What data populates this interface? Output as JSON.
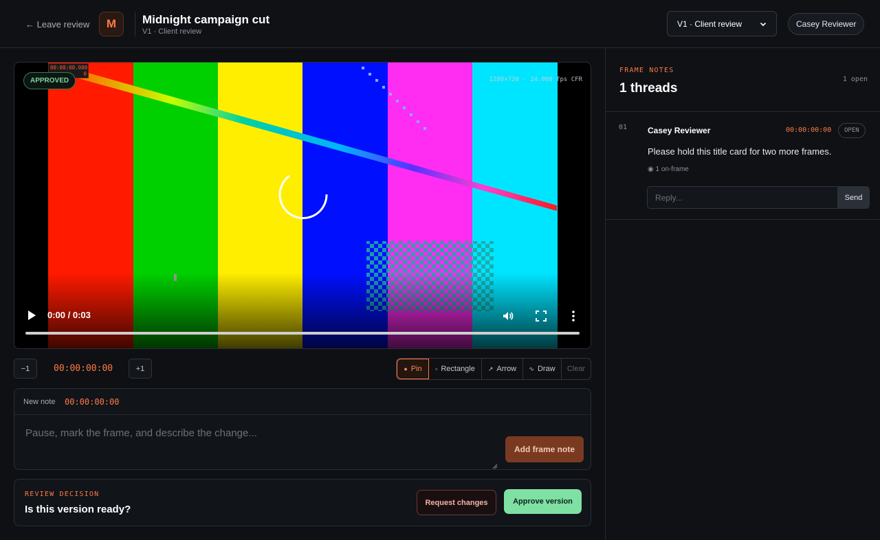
{
  "header": {
    "back_label": "← Leave review",
    "logo_letter": "M",
    "project_title": "Midnight campaign cut",
    "project_subtitle": "V1 · Client review",
    "version_select": "V1 · Client review",
    "user_name": "Casey Reviewer"
  },
  "player": {
    "status_badge": "APPROVED",
    "overlay_timecode": "00:00:00.000",
    "overlay_frame": "0",
    "resolution_label": "1280×720 · 24.000 fps CFR",
    "time_display": "0:00 / 0:03",
    "bar_colors": [
      "#ff1a00",
      "#00d000",
      "#ffee00",
      "#0010ff",
      "#ff2cf2",
      "#00e5ff"
    ]
  },
  "controls": {
    "step_back": "−1",
    "current_timecode": "00:00:00:00",
    "step_forward": "+1",
    "tools": [
      {
        "label": "Pin",
        "glyph": "●"
      },
      {
        "label": "Rectangle",
        "glyph": "▫"
      },
      {
        "label": "Arrow",
        "glyph": "↗"
      },
      {
        "label": "Draw",
        "glyph": "∿"
      },
      {
        "label": "Clear",
        "glyph": ""
      }
    ],
    "active_tool": "Pin"
  },
  "new_note": {
    "label": "New note",
    "timecode": "00:00:00:00",
    "placeholder": "Pause, mark the frame, and describe the change...",
    "submit_label": "Add frame note"
  },
  "decision": {
    "kicker": "REVIEW DECISION",
    "question": "Is this version ready?",
    "request_label": "Request changes",
    "approve_label": "Approve version"
  },
  "sidebar": {
    "kicker": "FRAME NOTES",
    "title": "1 threads",
    "open_count": "1 open",
    "threads": [
      {
        "index": "01",
        "author": "Casey Reviewer",
        "timecode": "00:00:00:00",
        "status": "OPEN",
        "body": "Please hold this title card for two more frames.",
        "meta": "◉ 1 on-frame",
        "reply_placeholder": "Reply...",
        "send_label": "Send"
      }
    ]
  },
  "colors": {
    "accent": "#ff7a45",
    "approve": "#7fe0a4",
    "background": "#0e1014"
  }
}
